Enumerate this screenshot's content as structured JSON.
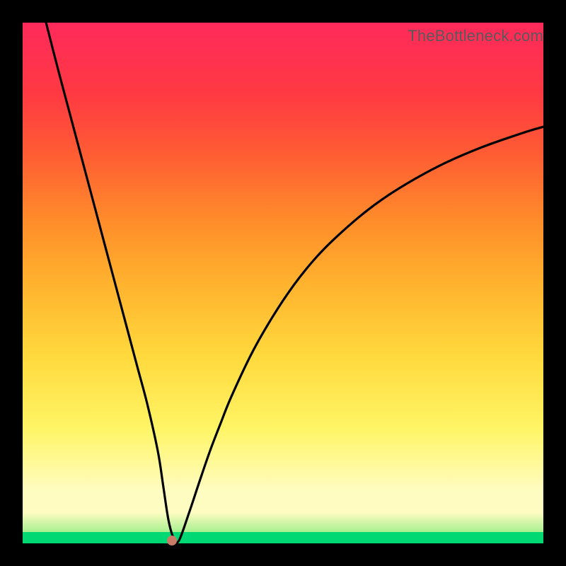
{
  "attribution": "TheBottleneck.com",
  "chart_data": {
    "type": "line",
    "title": "",
    "xlabel": "",
    "ylabel": "",
    "xlim": [
      0,
      100
    ],
    "ylim": [
      0,
      100
    ],
    "grid": false,
    "series": [
      {
        "name": "bottleneck-curve",
        "x": [
          4.5,
          6,
          8,
          10,
          12,
          14,
          16,
          18,
          20,
          22,
          24,
          26,
          27,
          28,
          29,
          30,
          32,
          34,
          36,
          38,
          40,
          44,
          48,
          52,
          56,
          60,
          66,
          72,
          80,
          88,
          96,
          100
        ],
        "values": [
          100,
          94,
          86.5,
          79,
          71.5,
          64,
          56.5,
          49,
          41.5,
          34,
          26.5,
          17.5,
          11,
          4.5,
          1,
          0.5,
          6,
          12,
          17.8,
          23,
          28,
          36.5,
          43.5,
          49.5,
          54.5,
          58.6,
          63.8,
          68,
          72.5,
          76,
          78.8,
          80
        ]
      }
    ],
    "marker": {
      "x": 28.7,
      "y": 0.6,
      "color": "#c97b67"
    },
    "background_gradient": {
      "top": "#ff2a5b",
      "mid_upper": "#ff8c2a",
      "mid": "#ffd93d",
      "mid_lower": "#fffcc2",
      "bottom_band": "#00d973"
    },
    "colors": {
      "frame": "#000000",
      "curve": "#000000",
      "attribution_text": "#5a5a5a"
    }
  }
}
